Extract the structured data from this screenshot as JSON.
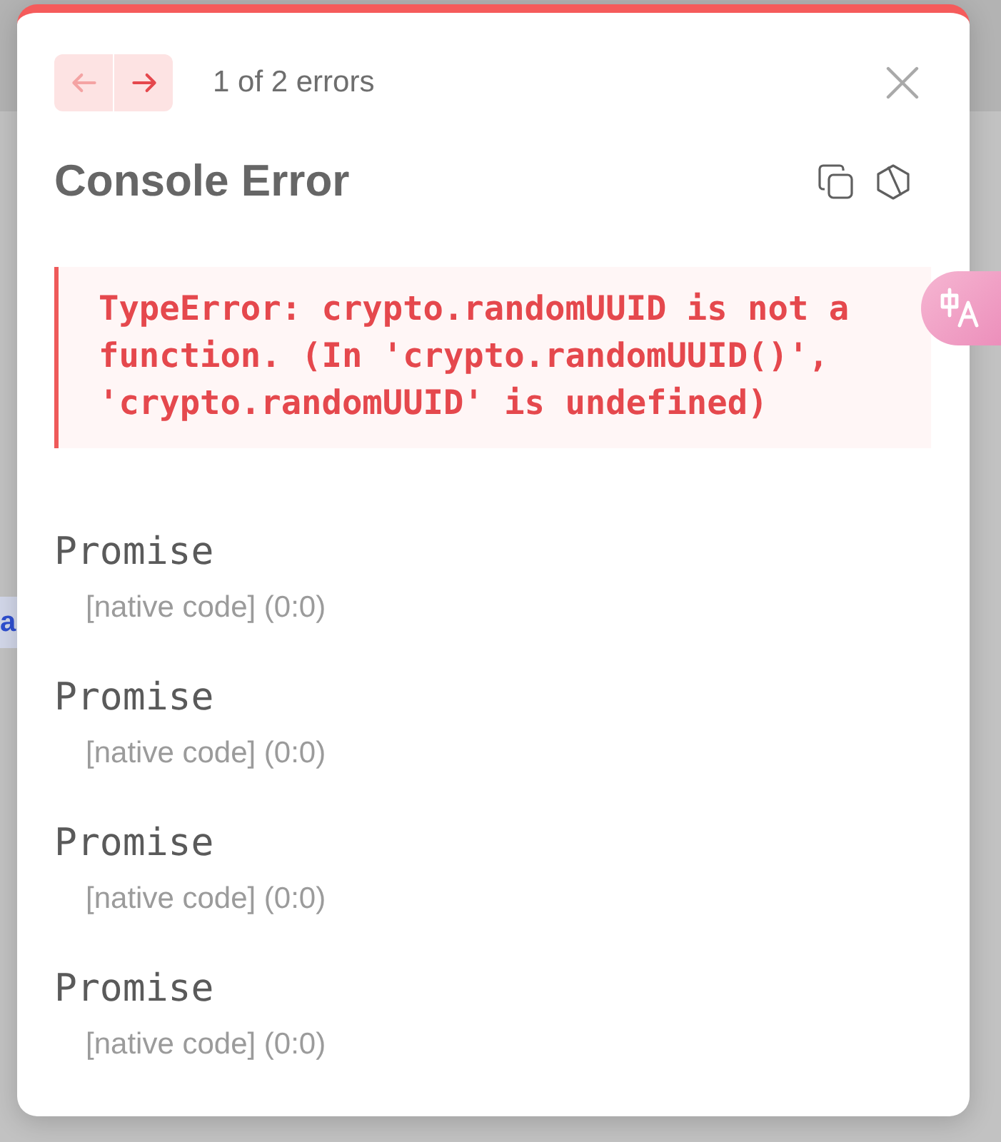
{
  "background_link_fragment": "a",
  "dialog": {
    "pager": {
      "buttons": [
        {
          "kind": "previous",
          "disabled": true
        },
        {
          "kind": "next",
          "disabled": false
        }
      ],
      "label": "1 of 2 errors"
    },
    "title": "Console Error",
    "error_message": "TypeError: crypto.randomUUID is not a function. (In 'crypto.randomUUID()', 'crypto.randomUUID' is undefined)",
    "stack_frames": [
      {
        "function": "Promise",
        "location": "[native code] (0:0)"
      },
      {
        "function": "Promise",
        "location": "[native code] (0:0)"
      },
      {
        "function": "Promise",
        "location": "[native code] (0:0)"
      },
      {
        "function": "Promise",
        "location": "[native code] (0:0)"
      }
    ]
  }
}
